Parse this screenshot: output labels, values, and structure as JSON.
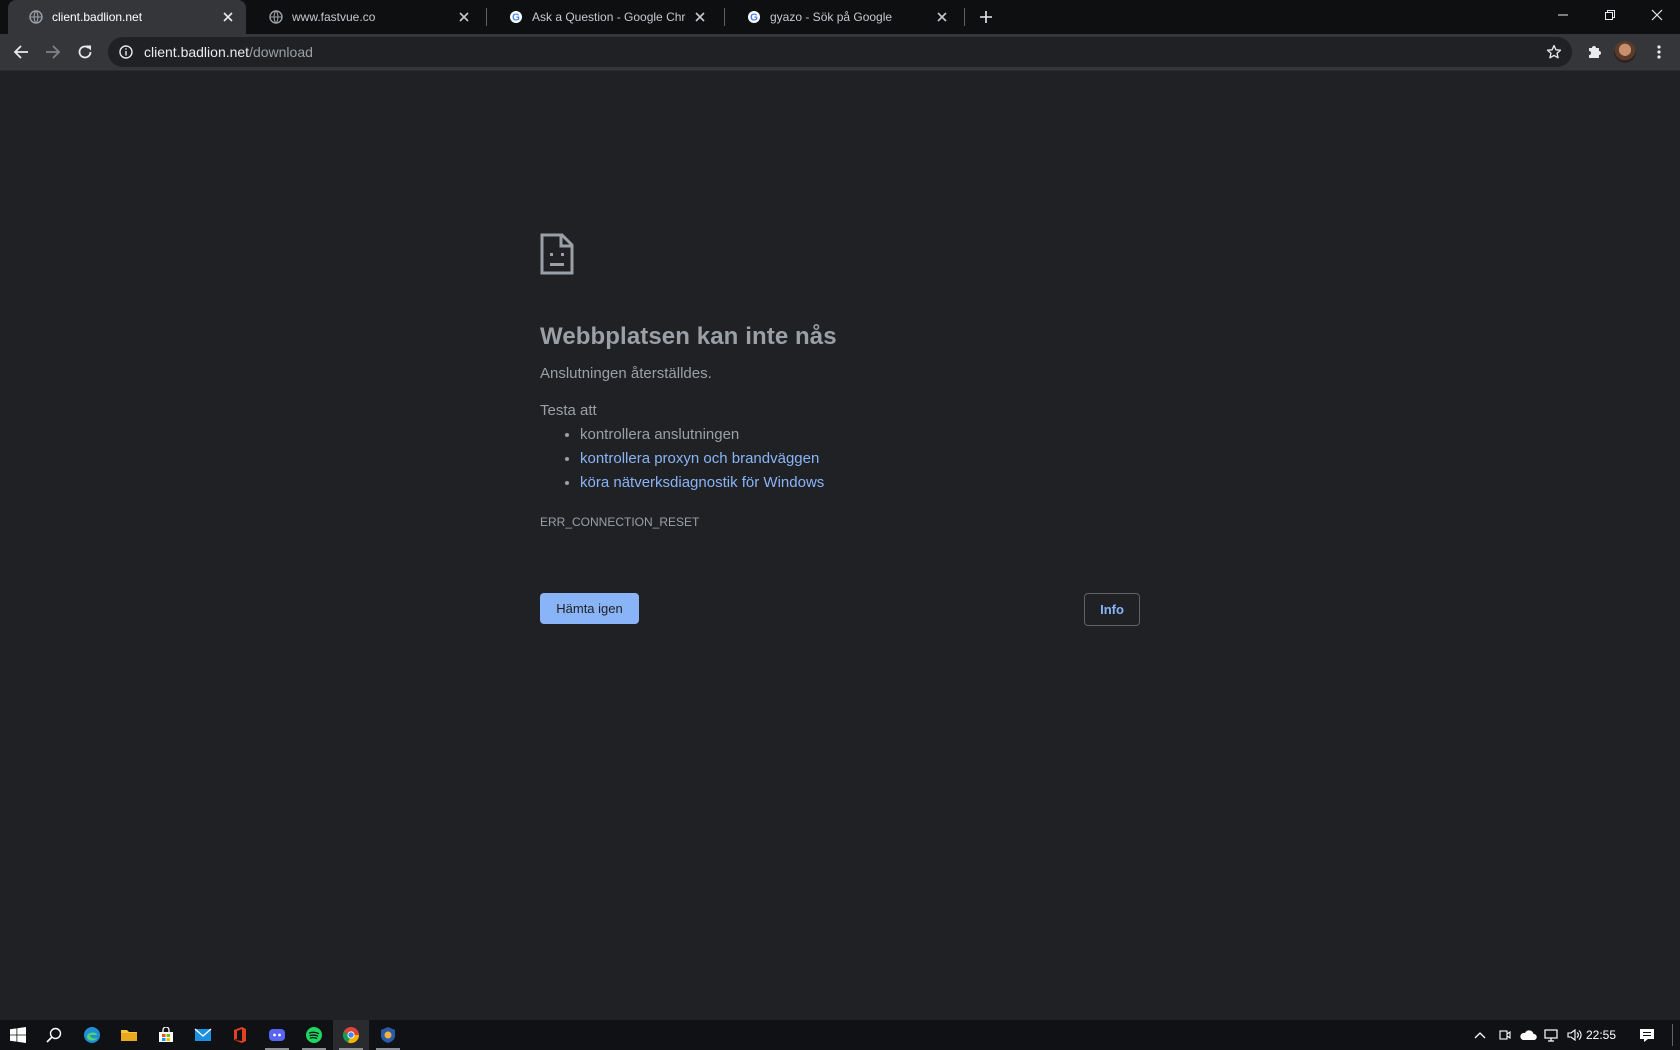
{
  "browser": {
    "tabs": [
      {
        "title": "client.badlion.net",
        "icon": "globe-icon",
        "active": true
      },
      {
        "title": "www.fastvue.co",
        "icon": "globe-icon",
        "active": false
      },
      {
        "title": "Ask a Question - Google Chrome",
        "icon": "google-icon",
        "active": false
      },
      {
        "title": "gyazo - Sök på Google",
        "icon": "google-icon",
        "active": false
      }
    ],
    "address": {
      "host": "client.badlion.net",
      "path": "/download"
    }
  },
  "page": {
    "heading": "Webbplatsen kan inte nås",
    "description": "Anslutningen återställdes.",
    "try_heading": "Testa att",
    "suggestions": [
      {
        "text": "kontrollera anslutningen",
        "link": false
      },
      {
        "text": "kontrollera proxyn och brandväggen",
        "link": true
      },
      {
        "text": "köra nätverksdiagnostik för Windows",
        "link": true
      }
    ],
    "error_code": "ERR_CONNECTION_RESET",
    "reload_label": "Hämta igen",
    "details_label": "Info"
  },
  "taskbar": {
    "apps": [
      "windows-start-icon",
      "search-icon",
      "edge-icon",
      "file-explorer-icon",
      "store-icon",
      "mail-icon",
      "office-icon",
      "discord-icon",
      "spotify-icon",
      "chrome-icon",
      "badlion-icon"
    ],
    "clock": "22:55"
  },
  "colors": {
    "background": "#202124",
    "link": "#8ab4f8",
    "button": "#8ab4f8"
  }
}
